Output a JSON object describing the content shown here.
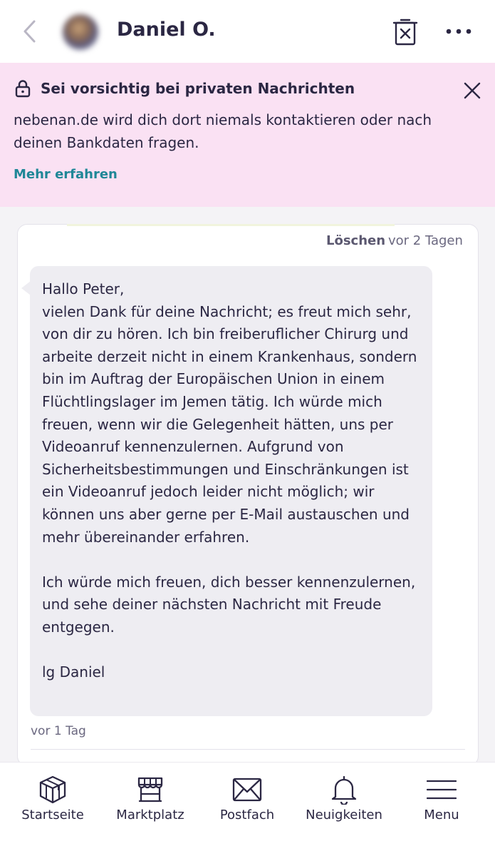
{
  "header": {
    "contact_name": "Daniel O.",
    "back_icon": "chevron-left-icon",
    "delete_icon": "trash-icon",
    "more_icon": "more-dots-icon"
  },
  "warning": {
    "title": "Sei vorsichtig bei privaten Nachrichten",
    "text": "nebenan.de wird dich dort niemals kontaktieren oder nach deinen Bankdaten fragen.",
    "link": "Mehr erfahren",
    "background": "#fae1f3",
    "link_color": "#1f8797"
  },
  "message": {
    "delete_label": "Löschen",
    "time_top": "vor 2 Tagen",
    "body": "Hallo Peter,\nvielen Dank für deine Nachricht; es freut mich sehr, von dir zu hören. Ich bin freiberuflicher Chirurg und arbeite derzeit nicht in einem Krankenhaus, sondern bin im Auftrag der Europäischen Union in einem Flüchtlingslager im Jemen tätig. Ich würde mich freuen, wenn wir die Gelegenheit hätten, uns per Videoanruf kennenzulernen. Aufgrund von Sicherheitsbestimmungen und Einschränkungen ist ein Videoanruf jedoch leider nicht möglich; wir können uns aber gerne per E-Mail austauschen und mehr übereinander erfahren.\n\nIch würde mich freuen, dich besser kennenzulernen, und sehe deiner nächsten Nachricht mit Freude entgegen.\n\nlg Daniel",
    "time_bottom": "vor 1 Tag"
  },
  "nav": {
    "items": [
      {
        "label": "Startseite",
        "icon": "home-cube-icon"
      },
      {
        "label": "Marktplatz",
        "icon": "market-stall-icon"
      },
      {
        "label": "Postfach",
        "icon": "envelope-icon"
      },
      {
        "label": "Neuigkeiten",
        "icon": "bell-icon"
      },
      {
        "label": "Menu",
        "icon": "hamburger-menu-icon"
      }
    ]
  }
}
